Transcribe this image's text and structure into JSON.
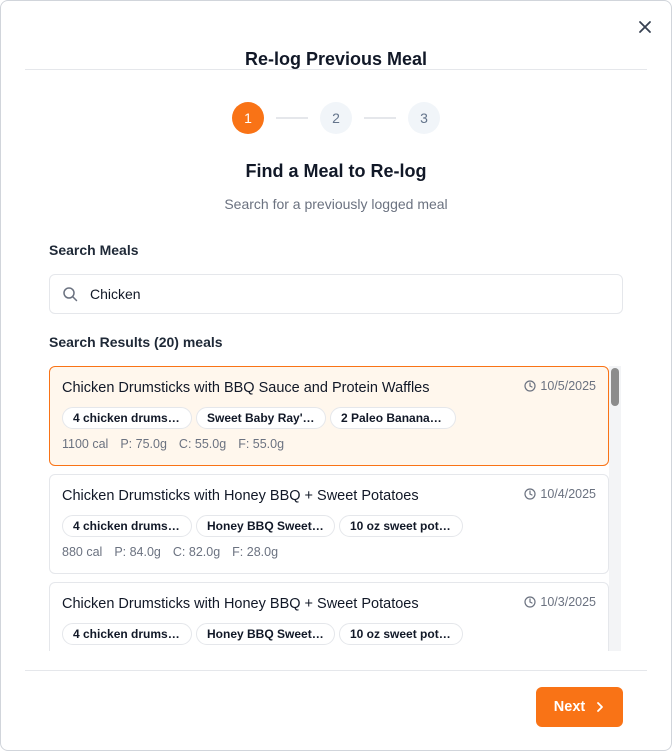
{
  "modal": {
    "title": "Re-log Previous Meal",
    "steps": [
      "1",
      "2",
      "3"
    ],
    "active_step": 1,
    "step_heading": "Find a Meal to Re-log",
    "step_subtitle": "Search for a previously logged meal"
  },
  "search": {
    "label": "Search Meals",
    "value": "Chicken"
  },
  "results": {
    "label": "Search Results (20) meals",
    "items": [
      {
        "title": "Chicken Drumsticks with BBQ Sauce and Protein Waffles",
        "date": "10/5/2025",
        "chips": [
          "4 chicken drums…",
          "Sweet Baby Ray'…",
          "2 Paleo Banana …"
        ],
        "calories": "1100 cal",
        "protein": "P: 75.0g",
        "carbs": "C: 55.0g",
        "fat": "F: 55.0g",
        "selected": true
      },
      {
        "title": "Chicken Drumsticks with Honey BBQ + Sweet Potatoes",
        "date": "10/4/2025",
        "chips": [
          "4 chicken drums…",
          "Honey BBQ Sweet…",
          "10 oz sweet pot…"
        ],
        "calories": "880 cal",
        "protein": "P: 84.0g",
        "carbs": "C: 82.0g",
        "fat": "F: 28.0g",
        "selected": false
      },
      {
        "title": "Chicken Drumsticks with Honey BBQ + Sweet Potatoes",
        "date": "10/3/2025",
        "chips": [
          "4 chicken drums…",
          "Honey BBQ Sweet…",
          "10 oz sweet pot…"
        ],
        "calories": "",
        "protein": "",
        "carbs": "",
        "fat": "",
        "selected": false
      }
    ]
  },
  "footer": {
    "next_label": "Next"
  },
  "colors": {
    "accent": "#f97316",
    "selected_bg": "#fff7ed"
  },
  "icons": {
    "close": "close-icon",
    "search": "search-icon",
    "clock": "clock-icon",
    "next": "chevron-right-icon"
  }
}
